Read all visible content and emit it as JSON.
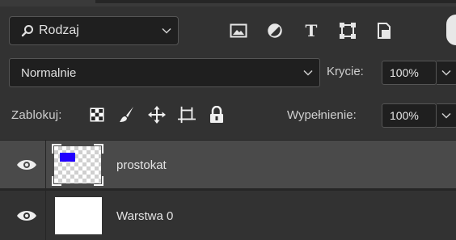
{
  "filter": {
    "kind_label": "Rodzaj",
    "icons": [
      "image-filter-icon",
      "adjustment-filter-icon",
      "type-filter-icon",
      "shape-filter-icon",
      "smart-object-filter-icon"
    ],
    "type_glyph": "T"
  },
  "blend": {
    "mode": "Normalnie",
    "opacity_label": "Krycie:",
    "opacity_value": "100%"
  },
  "lock": {
    "label": "Zablokuj:",
    "icons": [
      "lock-transparent-pixels-icon",
      "lock-image-pixels-icon",
      "lock-position-icon",
      "lock-artboard-icon",
      "lock-all-icon"
    ],
    "fill_label": "Wypełnienie:",
    "fill_value": "100%"
  },
  "layers": [
    {
      "name": "prostokat",
      "visible": true,
      "selected": true,
      "thumb_fill_color": "#2200ff"
    },
    {
      "name": "Warstwa 0",
      "visible": true,
      "selected": false,
      "thumb_fill_color": "#ffffff"
    }
  ],
  "colors": {
    "panel_bg": "#323232",
    "selected_row": "#4a4a4a",
    "field_bg": "#1f1f1f"
  }
}
